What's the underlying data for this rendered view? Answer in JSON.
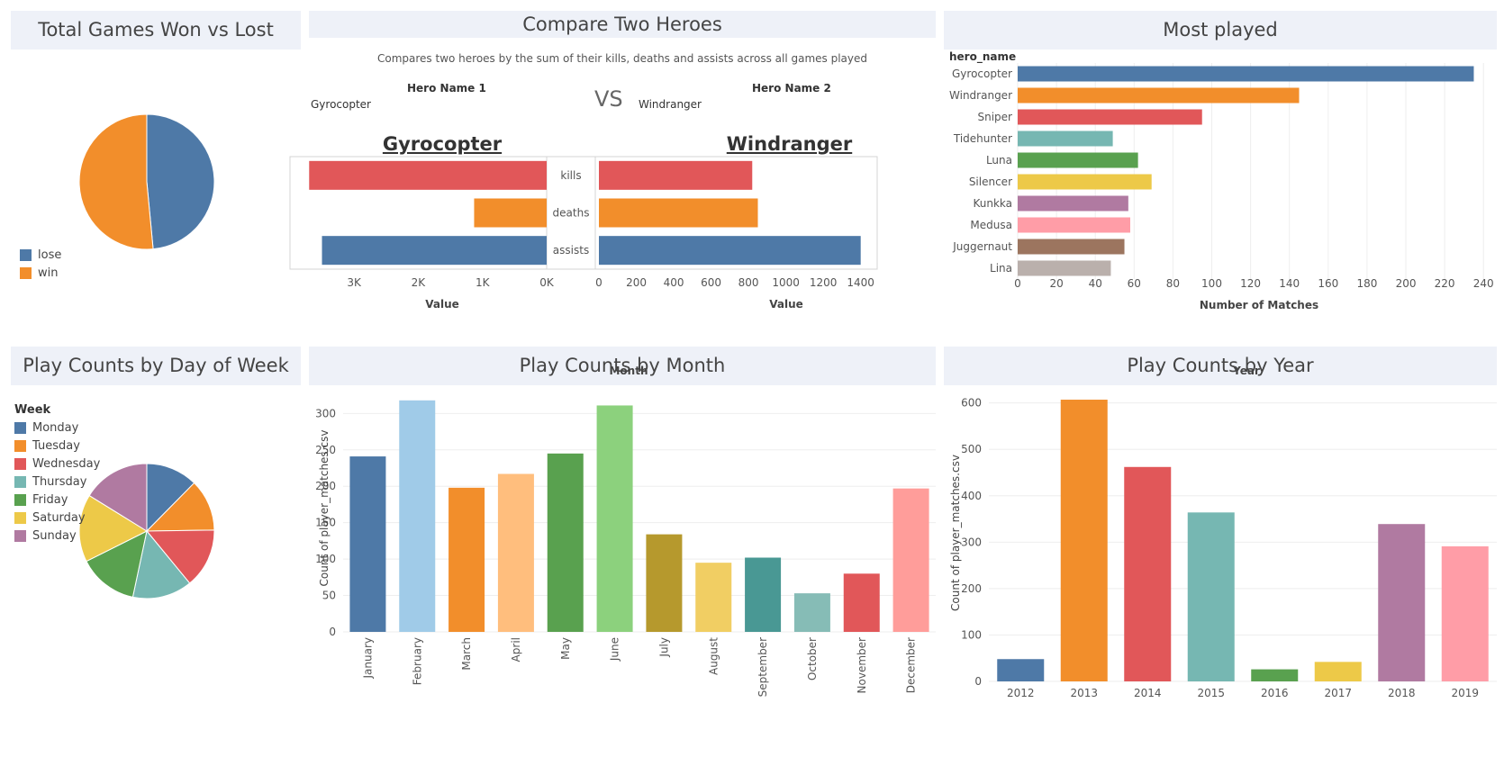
{
  "panels": {
    "winloss": {
      "title": "Total Games Won vs Lost"
    },
    "compare": {
      "title": "Compare Two Heroes",
      "subtitle": "Compares two heroes by the sum of their kills, deaths and assists across all games played",
      "hero1_label": "Hero Name 1",
      "hero1_value": "Gyrocopter",
      "hero2_label": "Hero Name 2",
      "hero2_value": "Windranger",
      "vs": "VS"
    },
    "most_played": {
      "title": "Most played"
    },
    "day": {
      "title": "Play Counts by Day of Week"
    },
    "month": {
      "title": "Play Counts by Month"
    },
    "year": {
      "title": "Play Counts by Year"
    }
  },
  "chart_data": [
    {
      "id": "winloss",
      "type": "pie",
      "labels": [
        "lose",
        "win"
      ],
      "values": [
        48.5,
        51.5
      ],
      "colors": [
        "#4e79a7",
        "#f28e2b"
      ]
    },
    {
      "id": "hero1",
      "type": "bar",
      "orientation": "horizontal-reversed",
      "title": "Gyrocopter",
      "categories": [
        "kills",
        "deaths",
        "assists"
      ],
      "values": [
        3700,
        1130,
        3500
      ],
      "colors": [
        "#e15759",
        "#f28e2b",
        "#4e79a7"
      ],
      "xlabel": "Value",
      "xlim": [
        0,
        3900
      ],
      "ticks": [
        3000,
        2000,
        1000,
        0
      ],
      "tick_labels": [
        "3K",
        "2K",
        "1K",
        "0K"
      ]
    },
    {
      "id": "hero2",
      "type": "bar",
      "orientation": "horizontal",
      "title": "Windranger",
      "categories": [
        "kills",
        "deaths",
        "assists"
      ],
      "values": [
        820,
        850,
        1400
      ],
      "colors": [
        "#e15759",
        "#f28e2b",
        "#4e79a7"
      ],
      "xlabel": "Value",
      "xlim": [
        0,
        1440
      ],
      "ticks": [
        0,
        200,
        400,
        600,
        800,
        1000,
        1200,
        1400
      ],
      "tick_labels": [
        "0",
        "200",
        "400",
        "600",
        "800",
        "1000",
        "1200",
        "1400"
      ]
    },
    {
      "id": "most_played",
      "type": "bar",
      "orientation": "horizontal",
      "ylabel": "hero_name",
      "xlabel": "Number of Matches",
      "categories": [
        "Gyrocopter",
        "Windranger",
        "Sniper",
        "Tidehunter",
        "Luna",
        "Silencer",
        "Kunkka",
        "Medusa",
        "Juggernaut",
        "Lina"
      ],
      "values": [
        235,
        145,
        95,
        49,
        62,
        69,
        57,
        58,
        55,
        48
      ],
      "colors": [
        "#4e79a7",
        "#f28e2b",
        "#e15759",
        "#76b7b2",
        "#59a14f",
        "#edc948",
        "#b07aa1",
        "#ff9da7",
        "#9c755f",
        "#bab0ac"
      ],
      "xlim": [
        0,
        245
      ],
      "ticks": [
        0,
        20,
        40,
        60,
        80,
        100,
        120,
        140,
        160,
        180,
        200,
        220,
        240
      ]
    },
    {
      "id": "day",
      "type": "pie",
      "legend_title": "Week",
      "labels": [
        "Monday",
        "Tuesday",
        "Wednesday",
        "Thursday",
        "Friday",
        "Saturday",
        "Sunday"
      ],
      "values": [
        13,
        13,
        15,
        15,
        15,
        17,
        17
      ],
      "colors": [
        "#4e79a7",
        "#f28e2b",
        "#e15759",
        "#76b7b2",
        "#59a14f",
        "#edc948",
        "#b07aa1"
      ]
    },
    {
      "id": "month",
      "type": "bar",
      "title": "Month",
      "ylabel": "Count of player_matches.csv",
      "categories": [
        "January",
        "February",
        "March",
        "April",
        "May",
        "June",
        "July",
        "August",
        "September",
        "October",
        "November",
        "December"
      ],
      "values": [
        241,
        318,
        198,
        217,
        245,
        311,
        134,
        95,
        102,
        53,
        80,
        197
      ],
      "colors": [
        "#4e79a7",
        "#a0cbe8",
        "#f28e2b",
        "#ffbe7d",
        "#59a14f",
        "#8cd17d",
        "#b6992d",
        "#f1ce63",
        "#499894",
        "#86bcb6",
        "#e15759",
        "#ff9d9a"
      ],
      "ylim": [
        0,
        340
      ],
      "ticks": [
        0,
        50,
        100,
        150,
        200,
        250,
        300
      ]
    },
    {
      "id": "year",
      "type": "bar",
      "title": "Year",
      "ylabel": "Count of player_matches.csv",
      "categories": [
        "2012",
        "2013",
        "2014",
        "2015",
        "2016",
        "2017",
        "2018",
        "2019"
      ],
      "values": [
        48,
        607,
        462,
        364,
        26,
        42,
        339,
        291
      ],
      "colors": [
        "#4e79a7",
        "#f28e2b",
        "#e15759",
        "#76b7b2",
        "#59a14f",
        "#edc948",
        "#b07aa1",
        "#ff9da7"
      ],
      "ylim": [
        0,
        640
      ],
      "ticks": [
        0,
        100,
        200,
        300,
        400,
        500,
        600
      ]
    }
  ]
}
